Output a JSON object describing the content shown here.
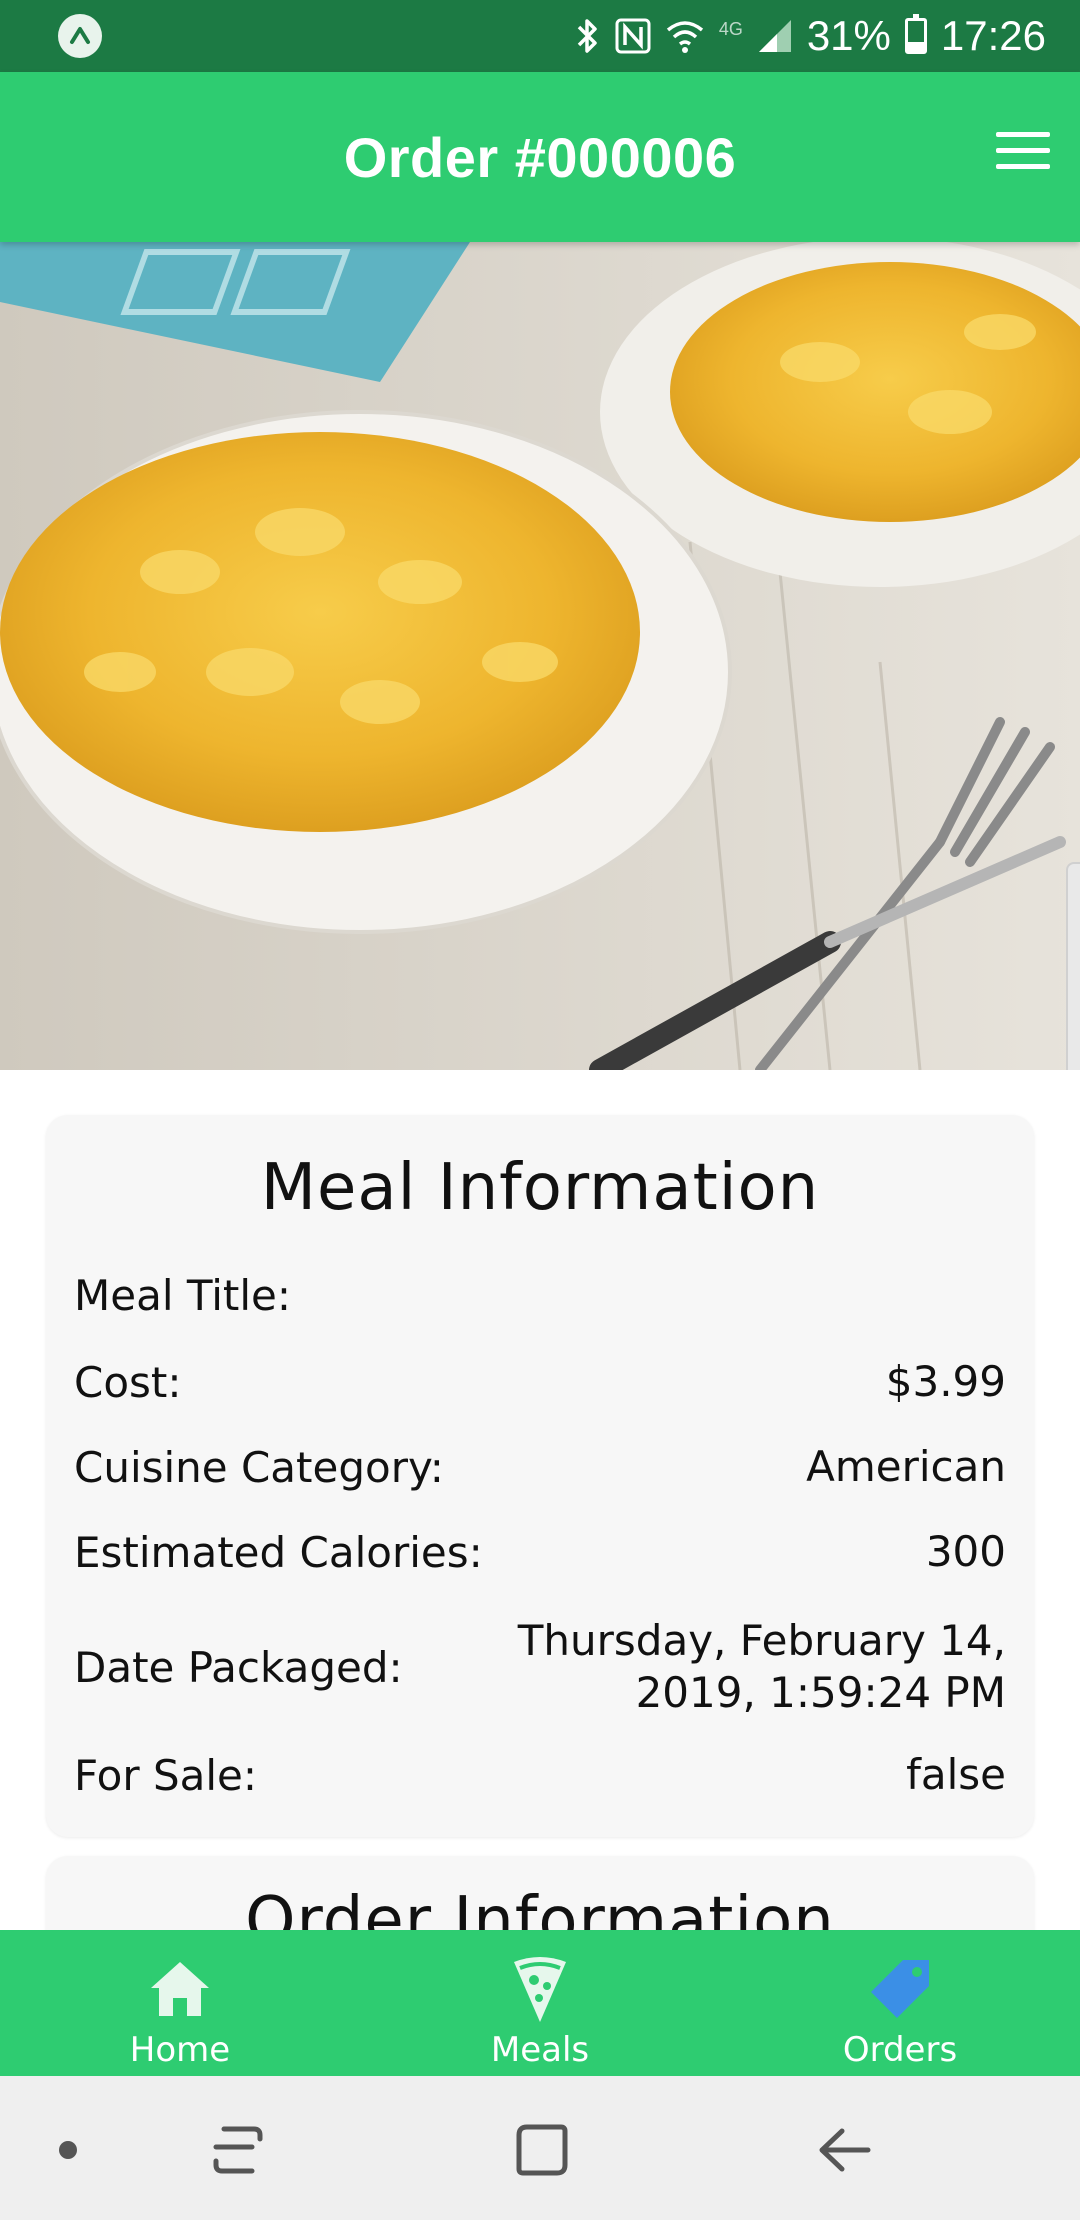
{
  "status_bar": {
    "battery": "31%",
    "time": "17:26",
    "network": "4G"
  },
  "header": {
    "title": "Order #000006"
  },
  "hero": {
    "image_alt": "Mac and cheese in white bowls with forks"
  },
  "meal_info": {
    "title": "Meal Information",
    "rows": [
      {
        "label": "Meal Title:",
        "value": ""
      },
      {
        "label": "Cost:",
        "value": "$3.99"
      },
      {
        "label": "Cuisine Category:",
        "value": "American"
      },
      {
        "label": "Estimated Calories:",
        "value": "300"
      },
      {
        "label": "Date Packaged:",
        "value": "Thursday, February 14, 2019, 1:59:24 PM"
      },
      {
        "label": "For Sale:",
        "value": "false"
      }
    ]
  },
  "order_info": {
    "title": "Order Information"
  },
  "tabs": [
    {
      "label": "Home",
      "icon": "home-icon",
      "active": false
    },
    {
      "label": "Meals",
      "icon": "pizza-icon",
      "active": false
    },
    {
      "label": "Orders",
      "icon": "tag-icon",
      "active": true
    }
  ],
  "colors": {
    "status_bar": "#1c7a44",
    "primary": "#2ecc71",
    "active_tab_icon": "#3b8fe6",
    "card_bg": "#f7f7f7"
  }
}
